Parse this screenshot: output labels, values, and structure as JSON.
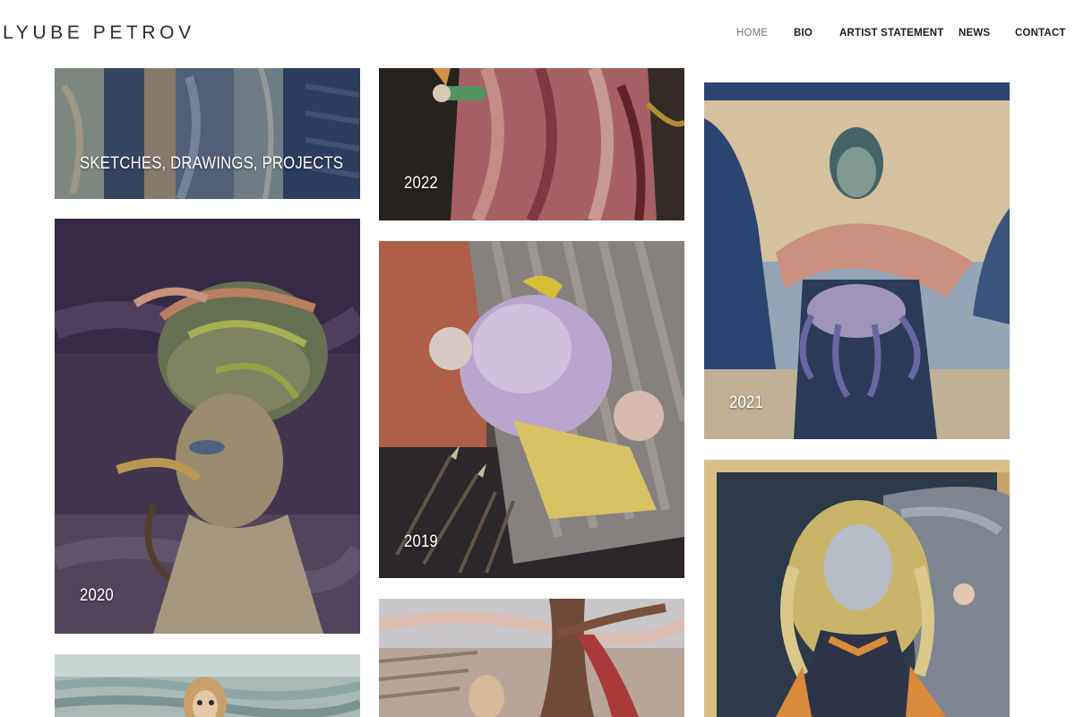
{
  "site": {
    "logo": "LYUBE PETROV"
  },
  "nav": {
    "items": [
      {
        "label": "HOME",
        "active": true
      },
      {
        "label": "BIO",
        "active": false
      },
      {
        "label": "ARTIST STATEMENT",
        "active": false
      },
      {
        "label": "NEWS",
        "active": false
      },
      {
        "label": "CONTACT",
        "active": false
      }
    ]
  },
  "gallery": {
    "tiles": [
      {
        "caption": "SKETCHES, DRAWINGS, PROJECTS"
      },
      {
        "caption": "2020"
      },
      {
        "caption": ""
      },
      {
        "caption": "2022"
      },
      {
        "caption": "2019"
      },
      {
        "caption": ""
      },
      {
        "caption": "2021"
      },
      {
        "caption": ""
      }
    ]
  },
  "colors": {
    "background": "#ffffff",
    "nav_active": "#777777",
    "nav_text": "#1d1d1d",
    "caption_text": "#ffffff"
  }
}
